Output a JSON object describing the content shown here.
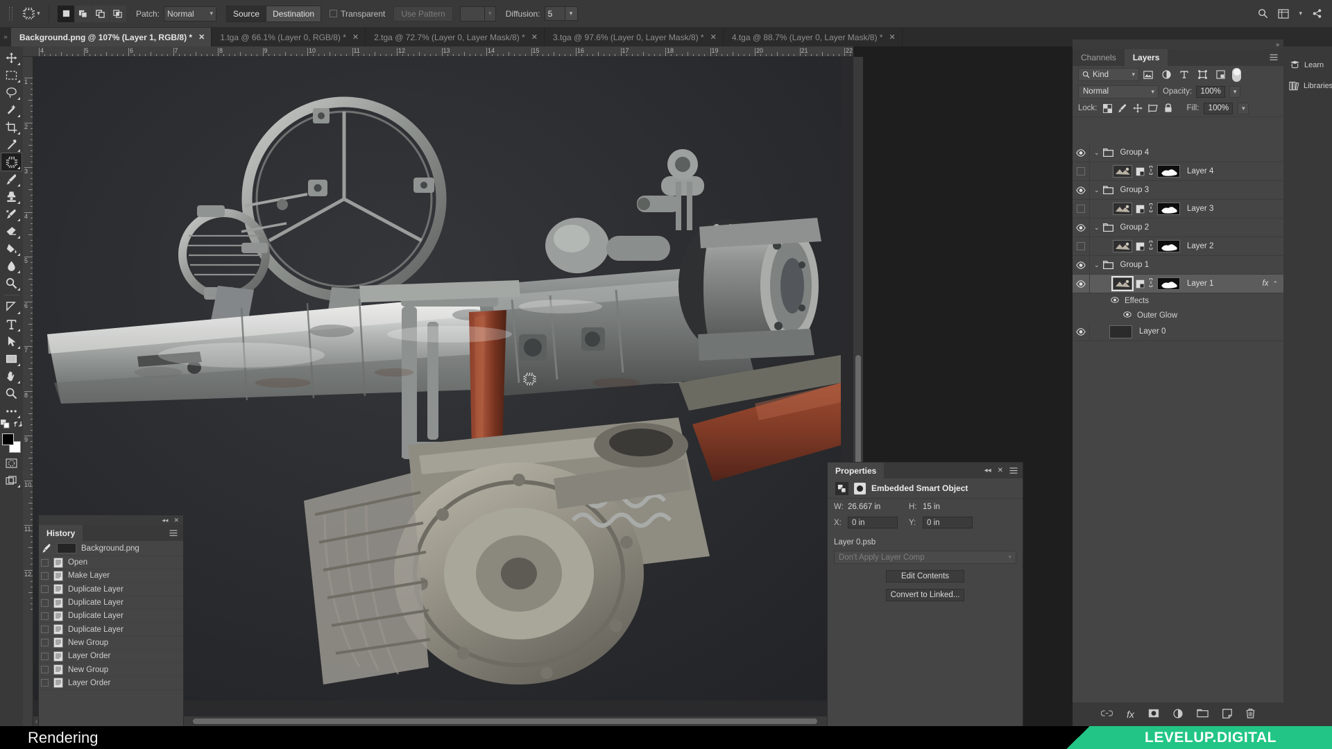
{
  "options_bar": {
    "tool_icon": "patch-tool-icon",
    "patch_modes": [
      "new-selection-icon",
      "add-to-selection-icon",
      "subtract-from-selection-icon",
      "intersect-selection-icon"
    ],
    "patch_label": "Patch:",
    "patch_value": "Normal",
    "source_label": "Source",
    "destination_label": "Destination",
    "transparent_label": "Transparent",
    "use_pattern_label": "Use Pattern",
    "diffusion_label": "Diffusion:",
    "diffusion_value": "5",
    "right_icons": [
      "search-icon",
      "workspace-icon",
      "chevron-down-icon",
      "share-icon"
    ]
  },
  "tabs": [
    {
      "label": "Background.png @ 107% (Layer 1, RGB/8) *",
      "active": true
    },
    {
      "label": "1.tga @ 66.1% (Layer 0, RGB/8) *",
      "active": false
    },
    {
      "label": "2.tga @ 72.7% (Layer 0, Layer Mask/8) *",
      "active": false
    },
    {
      "label": "3.tga @ 97.6% (Layer 0, Layer Mask/8) *",
      "active": false
    },
    {
      "label": "4.tga @ 88.7% (Layer 0, Layer Mask/8) *",
      "active": false
    }
  ],
  "tools": [
    {
      "name": "move-tool",
      "icon": "move-icon",
      "active": false
    },
    {
      "name": "rectangular-marquee-tool",
      "icon": "marquee-icon",
      "active": false
    },
    {
      "name": "lasso-tool",
      "icon": "lasso-icon",
      "active": false
    },
    {
      "name": "magic-wand-tool",
      "icon": "magic-wand-icon",
      "active": false
    },
    {
      "name": "crop-tool",
      "icon": "crop-icon",
      "active": false
    },
    {
      "name": "eyedropper-tool",
      "icon": "eyedropper-icon",
      "active": false
    },
    {
      "name": "patch-tool",
      "icon": "patch-icon",
      "active": true
    },
    {
      "name": "brush-tool",
      "icon": "brush-icon",
      "active": false
    },
    {
      "name": "clone-stamp-tool",
      "icon": "stamp-icon",
      "active": false
    },
    {
      "name": "history-brush-tool",
      "icon": "history-brush-icon",
      "active": false
    },
    {
      "name": "eraser-tool",
      "icon": "eraser-icon",
      "active": false
    },
    {
      "name": "gradient-tool",
      "icon": "paint-bucket-icon",
      "active": false
    },
    {
      "name": "blur-tool",
      "icon": "blur-drop-icon",
      "active": false
    },
    {
      "name": "dodge-tool",
      "icon": "dodge-icon",
      "active": false
    },
    {
      "name": "pen-tool",
      "icon": "pen-icon",
      "active": false
    },
    {
      "name": "type-tool",
      "icon": "type-icon",
      "active": false
    },
    {
      "name": "path-selection-tool",
      "icon": "path-arrow-icon",
      "active": false
    },
    {
      "name": "rectangle-tool",
      "icon": "rectangle-icon",
      "active": false
    },
    {
      "name": "hand-tool",
      "icon": "hand-icon",
      "active": false
    },
    {
      "name": "zoom-tool",
      "icon": "zoom-icon",
      "active": false
    },
    {
      "name": "edit-toolbar",
      "icon": "ellipsis-icon",
      "active": false
    }
  ],
  "ruler": {
    "unit": "in",
    "h_labels": [
      "4",
      "5",
      "6",
      "7",
      "8",
      "9",
      "10",
      "11",
      "12",
      "13",
      "14",
      "15",
      "16",
      "17",
      "18",
      "19",
      "20",
      "21",
      "22"
    ],
    "v_labels": [
      "1",
      "2",
      "3",
      "4",
      "5",
      "6",
      "7",
      "8",
      "9",
      "10",
      "11",
      "12"
    ]
  },
  "history": {
    "title": "History",
    "items": [
      {
        "label": "Background.png",
        "type": "snapshot"
      },
      {
        "label": "Open",
        "type": "state"
      },
      {
        "label": "Make Layer",
        "type": "state"
      },
      {
        "label": "Duplicate Layer",
        "type": "state"
      },
      {
        "label": "Duplicate Layer",
        "type": "state"
      },
      {
        "label": "Duplicate Layer",
        "type": "state"
      },
      {
        "label": "Duplicate Layer",
        "type": "state"
      },
      {
        "label": "New Group",
        "type": "state"
      },
      {
        "label": "Layer Order",
        "type": "state"
      },
      {
        "label": "New Group",
        "type": "state"
      },
      {
        "label": "Layer Order",
        "type": "state"
      }
    ]
  },
  "properties": {
    "title": "Properties",
    "subject": "Embedded Smart Object",
    "w_label": "W:",
    "w_value": "26.667 in",
    "h_label": "H:",
    "h_value": "15 in",
    "x_label": "X:",
    "x_value": "0 in",
    "y_label": "Y:",
    "y_value": "0 in",
    "file_name": "Layer 0.psb",
    "layer_comp": "Don't Apply Layer Comp",
    "edit_contents": "Edit Contents",
    "convert_to_linked": "Convert to Linked..."
  },
  "layers_panel": {
    "tabs": [
      {
        "label": "Channels",
        "active": false
      },
      {
        "label": "Layers",
        "active": true
      }
    ],
    "filter_kind": "Kind",
    "filter_icons": [
      "pixel-filter-icon",
      "adjustment-filter-icon",
      "type-filter-icon",
      "shape-filter-icon",
      "smart-object-filter-icon"
    ],
    "blend_mode": "Normal",
    "opacity_label": "Opacity:",
    "opacity_value": "100%",
    "lock_label": "Lock:",
    "lock_icons": [
      "lock-transparent-icon",
      "lock-image-icon",
      "lock-position-icon",
      "lock-artboard-icon",
      "lock-all-icon"
    ],
    "fill_label": "Fill:",
    "fill_value": "100%",
    "rows": [
      {
        "name": "Group 4",
        "type": "group",
        "visible": true,
        "selected": false
      },
      {
        "name": "Layer 4",
        "type": "layer",
        "visible": false,
        "selected": false
      },
      {
        "name": "Group 3",
        "type": "group",
        "visible": true,
        "selected": false
      },
      {
        "name": "Layer 3",
        "type": "layer",
        "visible": false,
        "selected": false
      },
      {
        "name": "Group 2",
        "type": "group",
        "visible": true,
        "selected": false
      },
      {
        "name": "Layer 2",
        "type": "layer",
        "visible": false,
        "selected": false
      },
      {
        "name": "Group 1",
        "type": "group",
        "visible": true,
        "selected": false
      },
      {
        "name": "Layer 1",
        "type": "layer",
        "visible": true,
        "selected": true,
        "fx": "fx"
      },
      {
        "name": "Effects",
        "type": "effects",
        "visible": true,
        "selected": false
      },
      {
        "name": "Outer Glow",
        "type": "effect",
        "visible": true,
        "selected": false
      },
      {
        "name": "Layer 0",
        "type": "base",
        "visible": true,
        "selected": false
      }
    ],
    "bottom_icons": [
      "link-layers-icon",
      "add-style-icon",
      "add-mask-icon",
      "adjustment-layer-icon",
      "new-group-icon",
      "new-layer-icon",
      "delete-layer-icon"
    ]
  },
  "right_dock": [
    {
      "label": "Learn",
      "icon": "learn-icon"
    },
    {
      "label": "Libraries",
      "icon": "libraries-icon"
    }
  ],
  "bottom": {
    "status": "Rendering",
    "watermark": "LEVELUP.DIGITAL"
  },
  "colors": {
    "accent_green": "#22c585",
    "panel_bg": "#393939",
    "panel_body": "#454545",
    "canvas_bg": "#2a2a2c",
    "selected_row": "#5c5c5c",
    "foreground_swatch": "#000000",
    "background_swatch": "#ffffff"
  }
}
